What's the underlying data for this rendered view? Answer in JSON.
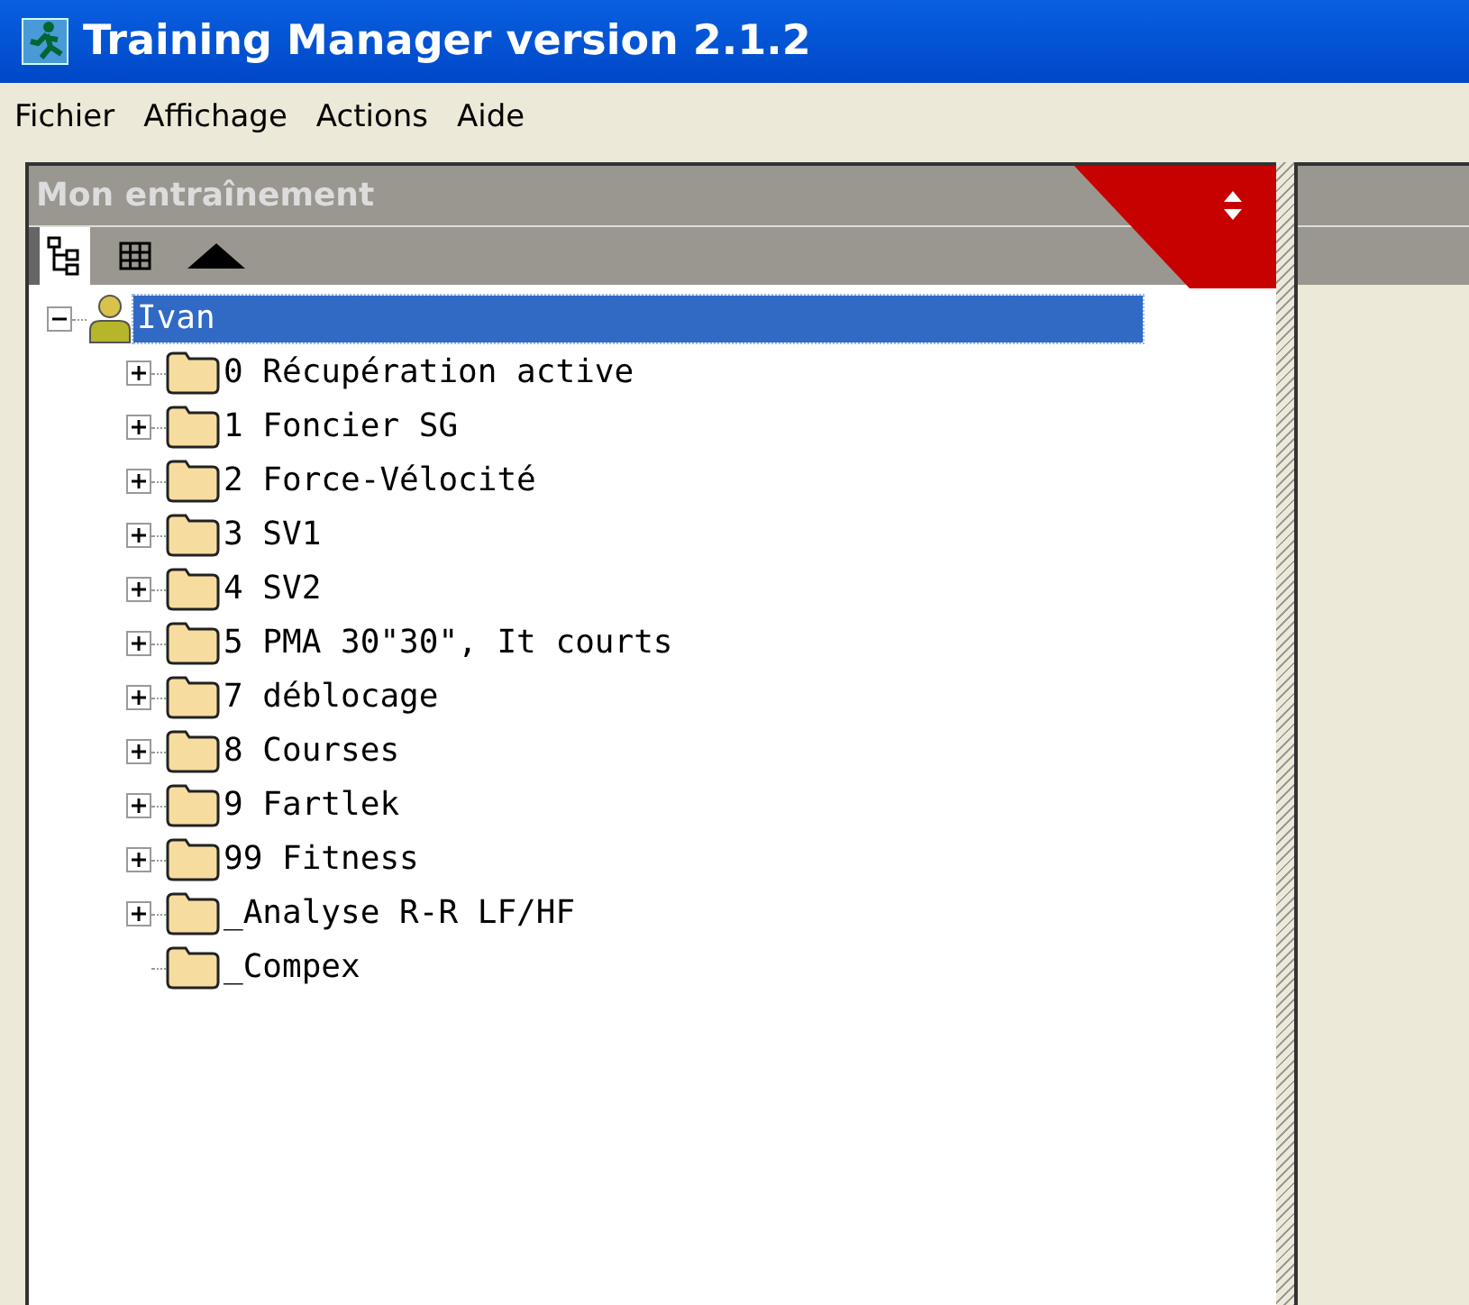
{
  "window": {
    "title": "Training Manager version 2.1.2"
  },
  "menu": [
    "Fichier",
    "Affichage",
    "Actions",
    "Aide"
  ],
  "panel": {
    "title": "Mon entraînement",
    "toolbar": [
      {
        "kind": "tree",
        "selected": true
      },
      {
        "kind": "grid",
        "selected": false
      },
      {
        "kind": "up",
        "selected": false
      }
    ],
    "tree": [
      {
        "label": "Ivan",
        "kind": "person",
        "expanded": true,
        "selected": true,
        "children": [
          {
            "label": "0 Récupération active",
            "kind": "folder",
            "expanded": false,
            "selected": false
          },
          {
            "label": "1 Foncier SG",
            "kind": "folder",
            "expanded": false,
            "selected": false
          },
          {
            "label": "2 Force-Vélocité",
            "kind": "folder",
            "expanded": false,
            "selected": false
          },
          {
            "label": "3 SV1",
            "kind": "folder",
            "expanded": false,
            "selected": false
          },
          {
            "label": "4 SV2",
            "kind": "folder",
            "expanded": false,
            "selected": false
          },
          {
            "label": "5 PMA 30\"30\", It courts",
            "kind": "folder",
            "expanded": false,
            "selected": false
          },
          {
            "label": "7 déblocage",
            "kind": "folder",
            "expanded": false,
            "selected": false
          },
          {
            "label": "8 Courses",
            "kind": "folder",
            "expanded": false,
            "selected": false
          },
          {
            "label": "9 Fartlek",
            "kind": "folder",
            "expanded": false,
            "selected": false
          },
          {
            "label": "99 Fitness",
            "kind": "folder",
            "expanded": false,
            "selected": false
          },
          {
            "label": "_Analyse R-R LF/HF",
            "kind": "folder",
            "expanded": false,
            "selected": false
          },
          {
            "label": "_Compex",
            "kind": "folder",
            "selected": false
          }
        ]
      }
    ]
  }
}
